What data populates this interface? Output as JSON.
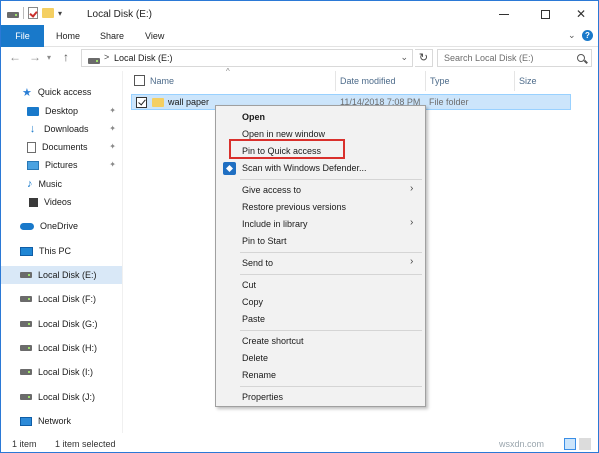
{
  "window": {
    "title": "Local Disk (E:)"
  },
  "ribbon": {
    "tabs": [
      "File",
      "Home",
      "Share",
      "View"
    ]
  },
  "address": {
    "path": "Local Disk (E:)",
    "separator": ">"
  },
  "search": {
    "placeholder": "Search Local Disk (E:)"
  },
  "sidebar": {
    "items": [
      {
        "label": "Quick access",
        "icon": "star-icon",
        "pinned": false
      },
      {
        "label": "Desktop",
        "icon": "desktop-icon",
        "pinned": true
      },
      {
        "label": "Downloads",
        "icon": "downloads-icon",
        "pinned": true
      },
      {
        "label": "Documents",
        "icon": "documents-icon",
        "pinned": true
      },
      {
        "label": "Pictures",
        "icon": "pictures-icon",
        "pinned": true
      },
      {
        "label": "Music",
        "icon": "music-icon",
        "pinned": false
      },
      {
        "label": "Videos",
        "icon": "videos-icon",
        "pinned": false
      },
      {
        "label": "OneDrive",
        "icon": "onedrive-icon",
        "pinned": false
      },
      {
        "label": "This PC",
        "icon": "this-pc-icon",
        "pinned": false
      },
      {
        "label": "Local Disk (E:)",
        "icon": "drive-icon",
        "selected": true
      },
      {
        "label": "Local Disk (F:)",
        "icon": "drive-icon"
      },
      {
        "label": "Local Disk (G:)",
        "icon": "drive-icon"
      },
      {
        "label": "Local Disk (H:)",
        "icon": "drive-icon"
      },
      {
        "label": "Local Disk (I:)",
        "icon": "drive-icon"
      },
      {
        "label": "Local Disk (J:)",
        "icon": "drive-icon"
      },
      {
        "label": "Network",
        "icon": "network-icon"
      }
    ]
  },
  "columns": {
    "name": "Name",
    "date": "Date modified",
    "type": "Type",
    "size": "Size"
  },
  "files": [
    {
      "name": "wall paper",
      "date": "11/14/2018 7:08 PM",
      "type": "File folder",
      "checked": true
    }
  ],
  "context_menu": {
    "open": "Open",
    "open_new_window": "Open in new window",
    "pin_quick_access": "Pin to Quick access",
    "scan_defender": "Scan with Windows Defender...",
    "give_access": "Give access to",
    "restore_versions": "Restore previous versions",
    "include_library": "Include in library",
    "pin_start": "Pin to Start",
    "send_to": "Send to",
    "cut": "Cut",
    "copy": "Copy",
    "paste": "Paste",
    "create_shortcut": "Create shortcut",
    "delete": "Delete",
    "rename": "Rename",
    "properties": "Properties"
  },
  "status": {
    "count": "1 item",
    "selected": "1 item selected"
  },
  "watermark": "wsxdn.com",
  "colors": {
    "accent": "#1979ca",
    "highlight": "#d9302c",
    "selection": "#cce5fb"
  }
}
